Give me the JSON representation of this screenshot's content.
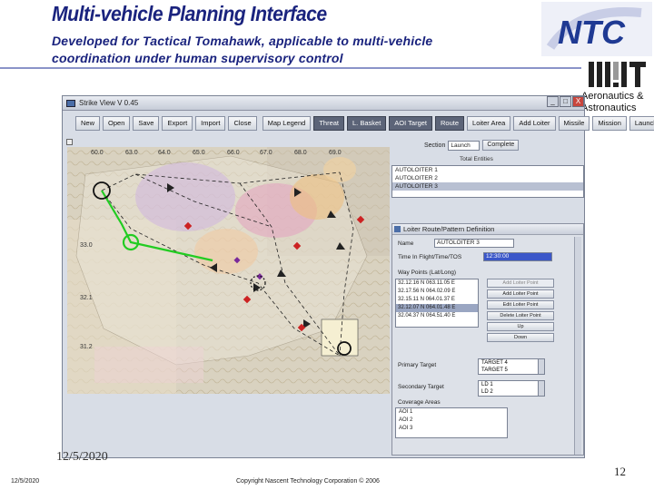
{
  "slide": {
    "title": "Multi-vehicle Planning Interface",
    "subtitle": "Developed for Tactical Tomahawk, applicable to multi-vehicle coordination under human supervisory control",
    "mit_caption": "Aeronautics &\nAstronautics",
    "footer_date_big": "12/5/2020",
    "footer_date_small": "12/5/2020",
    "copyright": "Copyright Nascent Technology Corporation © 2006",
    "page_number": "12"
  },
  "window": {
    "title": "Strike View V 0.45",
    "controls": [
      "_",
      "□",
      "X"
    ]
  },
  "toolbar": {
    "left": [
      "New",
      "Open",
      "Save",
      "Export",
      "Import",
      "Close"
    ],
    "right": [
      "Map Legend",
      "Threat",
      "Basket",
      "AOI",
      "Target",
      "Route",
      "Loiter Area",
      "Add Loiter",
      "Missile",
      "Mission",
      "Launch"
    ],
    "right_labels": [
      "Map Legend",
      "Threat",
      "L. Basket",
      "AOI Target",
      "Route",
      "Loiter Area",
      "Add Loiter",
      "Missile",
      "Mission",
      "Launch"
    ]
  },
  "map": {
    "lat_labels": [
      "33.0",
      "32.1",
      "31.2"
    ],
    "lon_labels": [
      "60.0",
      "63.0",
      "64.0",
      "65.0",
      "66.0",
      "67.0",
      "68.0",
      "69.0"
    ],
    "colors": {
      "route_green": "#22cc22",
      "target_red": "#cc2222",
      "loiter_purple": "#7a2a9a"
    }
  },
  "right_panel": {
    "section_label": "Section",
    "section_value": "Launch",
    "complete_label": "Complete",
    "entities_label": "Total Entities",
    "entities": [
      "AUTOLOITER 1",
      "AUTOLOITER 2",
      "AUTOLOITER 3"
    ],
    "selected_entity_index": 2
  },
  "loiter": {
    "title": "Loiter Route/Pattern Definition",
    "name_label": "Name",
    "name_value": "AUTOLOITER 3",
    "time_label": "Time In Flight/Time/TOS",
    "time_value": "12:30:00",
    "waypoints_label": "Way Points (Lat/Long)",
    "waypoints": [
      "32.12.16 N 063.11.05 E",
      "32.17.56 N 064.02.09 E",
      "32.15.11 N 064.01.37 E",
      "32.12.07 N 064.01.48 E",
      "32.04.37 N 064.51.40 E"
    ],
    "selected_waypoint_index": 3,
    "buttons": [
      "Add Loiter Point",
      "Add Loiter Point",
      "Edit Loiter Point",
      "Delete Loiter Point",
      "Up",
      "Down"
    ],
    "primary_label": "Primary Target",
    "primary_options": [
      "TARGET 4",
      "TARGET 5"
    ],
    "secondary_label": "Secondary Target",
    "secondary_options": [
      "LD 1",
      "LD 2"
    ],
    "coverage_label": "Coverage Areas",
    "coverage": [
      "AOI 1",
      "AOI 2",
      "AOI 3"
    ]
  }
}
